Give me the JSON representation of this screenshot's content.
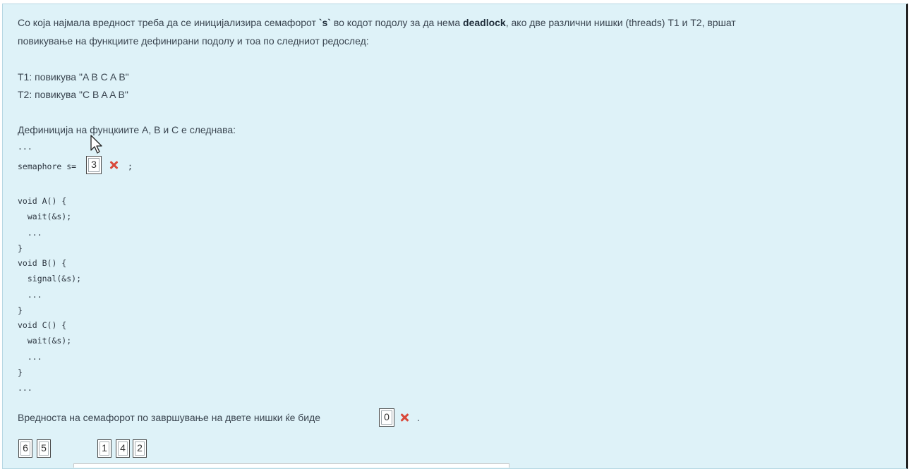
{
  "question": {
    "line1_before": "Со која најмала вредност треба да се иницијализира семафорот ",
    "semaphore_name": "`s`",
    "line1_middle": " во кодот подолу за да нема ",
    "deadlock_word": "deadlock",
    "line1_after": ", ако две различни нишки (threads) T1 и T2, вршат",
    "line2": "повикување на функциите дефинирани подолу и тоа по следниот редослед:",
    "t1": "T1: повикува \"A B C A B\"",
    "t2": "T2: повикува \"C B A A B\"",
    "definition_intro": "Дефиниција на фунцкиите A, B и C е следнава:"
  },
  "code": {
    "ellipsis_top": "...",
    "semaphore_prefix": "semaphore s=",
    "semaphore_suffix": ";",
    "lines": [
      "void A() {",
      "  wait(&s);",
      "  ...",
      "}",
      "void B() {",
      "  signal(&s);",
      "  ...",
      "}",
      "void C() {",
      "  wait(&s);",
      "  ...",
      "}",
      "..."
    ]
  },
  "answers": {
    "semaphore_init_value": "3",
    "final_value_sentence": "Вредноста на семафорот по завршување на двете нишки ќе биде",
    "final_value": "0",
    "final_value_suffix": ".",
    "status_icon": "cross-icon"
  },
  "draggable_options": {
    "group1": [
      "6",
      "5"
    ],
    "group2": [
      "1",
      "4",
      "2"
    ]
  },
  "colors": {
    "panel_background": "#def2f8",
    "incorrect_mark": "#d9493a"
  }
}
